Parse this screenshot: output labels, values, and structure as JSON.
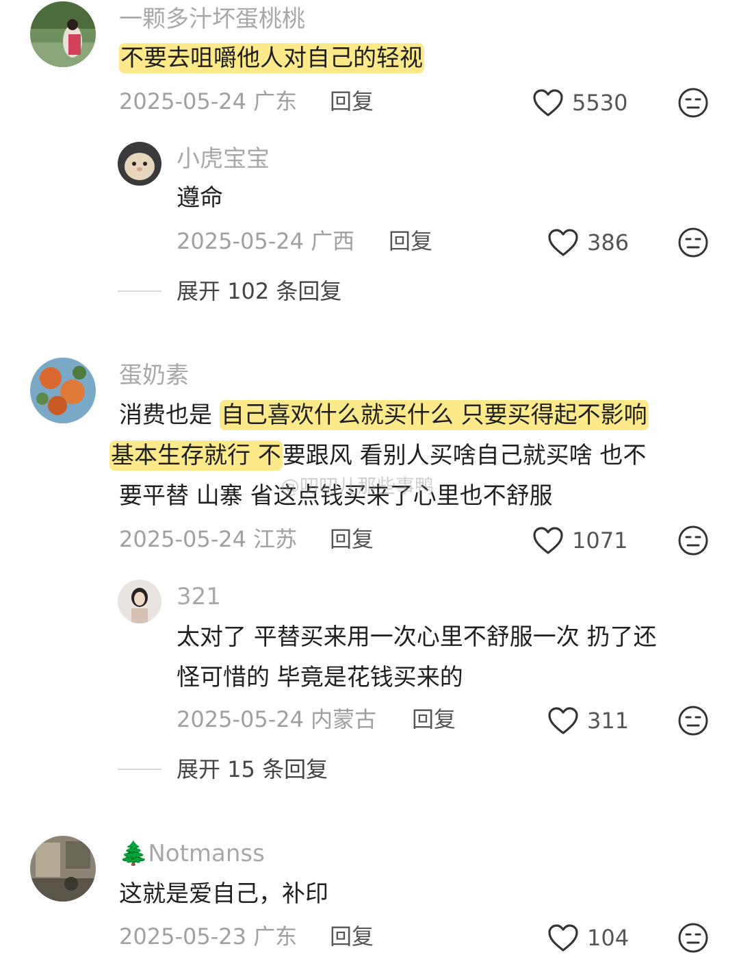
{
  "comments": [
    {
      "username": "一颗多汁坏蛋桃桃",
      "text_line1": "不要去咀嚼他人对自己的轻视",
      "date_location": "2025-05-24 广东",
      "reply_label": "回复",
      "likes": "5530",
      "replies": [
        {
          "username": "小虎宝宝",
          "text": "遵命",
          "date_location": "2025-05-24 广西",
          "reply_label": "回复",
          "likes": "386"
        }
      ],
      "expand_label": "展开 102 条回复"
    },
    {
      "username": "蛋奶素",
      "text_line1_plain": "消费也是",
      "text_line1_highlight": "自己喜欢什么就买什么 只要买得起不影响",
      "text_line2_highlight": "基本生存就行 不",
      "text_line2_plain": "要跟风 看别人买啥自己就买啥 也不",
      "text_line3": "要平替 山寨 省这点钱买来了心里也不舒服",
      "date_location": "2025-05-24 江苏",
      "reply_label": "回复",
      "likes": "1071",
      "replies": [
        {
          "username": "321",
          "text_line1": "太对了 平替买来用一次心里不舒服一次 扔了还",
          "text_line2": "怪可惜的 毕竟是花钱买来的",
          "date_location": "2025-05-24 内蒙古",
          "reply_label": "回复",
          "likes": "311"
        }
      ],
      "expand_label": "展开 15 条回复"
    },
    {
      "username_icon": "🌲",
      "username": "Notmanss",
      "text": "这就是爱自己，补印",
      "date_location": "2025-05-23 广东",
      "reply_label": "回复",
      "likes": "104"
    }
  ],
  "watermark": "@叨叨儿那些事鸭",
  "icons": {
    "like": "heart-outline-icon",
    "dislike": "neutral-face-icon"
  },
  "colors": {
    "highlight": "#fce98a",
    "username": "#a8a8a8",
    "meta": "#a0a0a0"
  }
}
